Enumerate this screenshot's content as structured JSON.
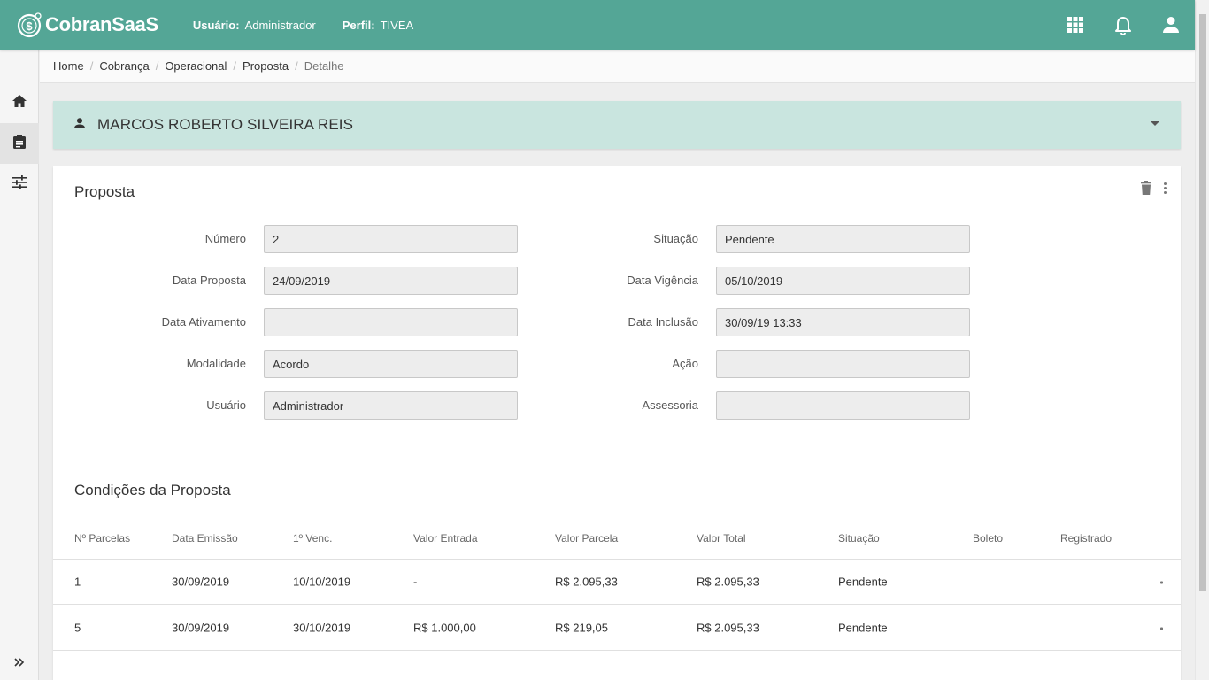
{
  "app": {
    "logo_text": "CobranSaaS"
  },
  "top_info": {
    "user_label": "Usuário:",
    "user_value": "Administrador",
    "profile_label": "Perfil:",
    "profile_value": "TIVEA"
  },
  "top_icons": [
    "apps-grid-icon",
    "bell-icon",
    "account-icon"
  ],
  "sidebar": {
    "items": [
      "home-icon",
      "clipboard-icon",
      "sliders-icon"
    ],
    "expand_icon": "double-chevron-right-icon"
  },
  "breadcrumb": [
    "Home",
    "Cobrança",
    "Operacional",
    "Proposta",
    "Detalhe"
  ],
  "customer": {
    "name": "MARCOS ROBERTO SILVEIRA REIS"
  },
  "proposal": {
    "title": "Proposta",
    "fields": {
      "numero": {
        "label": "Número",
        "value": "2"
      },
      "data_proposta": {
        "label": "Data Proposta",
        "value": "24/09/2019"
      },
      "data_ativamento": {
        "label": "Data Ativamento",
        "value": ""
      },
      "modalidade": {
        "label": "Modalidade",
        "value": "Acordo"
      },
      "usuario": {
        "label": "Usuário",
        "value": "Administrador"
      },
      "situacao": {
        "label": "Situação",
        "value": "Pendente"
      },
      "data_vigencia": {
        "label": "Data Vigência",
        "value": "05/10/2019"
      },
      "data_inclusao": {
        "label": "Data Inclusão",
        "value": "30/09/19 13:33"
      },
      "acao": {
        "label": "Ação",
        "value": ""
      },
      "assessoria": {
        "label": "Assessoria",
        "value": ""
      }
    }
  },
  "conditions": {
    "title": "Condições da Proposta",
    "columns": [
      "Nº Parcelas",
      "Data Emissão",
      "1º Venc.",
      "Valor Entrada",
      "Valor Parcela",
      "Valor Total",
      "Situação",
      "Boleto",
      "Registrado"
    ],
    "rows": [
      [
        "1",
        "30/09/2019",
        "10/10/2019",
        "-",
        "R$ 2.095,33",
        "R$ 2.095,33",
        "Pendente",
        "",
        ""
      ],
      [
        "5",
        "30/09/2019",
        "30/10/2019",
        "R$ 1.000,00",
        "R$ 219,05",
        "R$ 2.095,33",
        "Pendente",
        "",
        ""
      ]
    ]
  },
  "colors": {
    "primary": "#54a696",
    "customer_bg": "#c9e5df"
  }
}
